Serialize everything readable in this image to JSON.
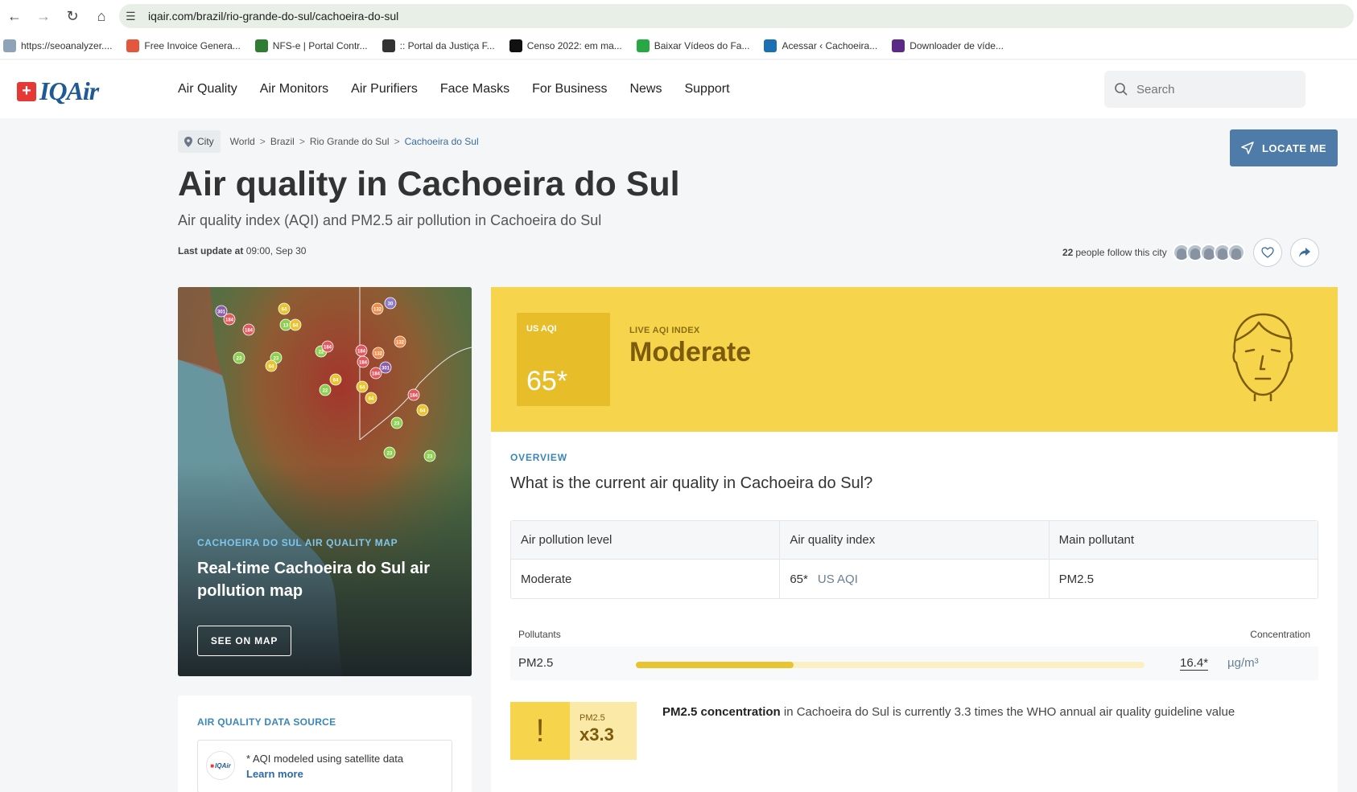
{
  "browser": {
    "url": "iqair.com/brazil/rio-grande-do-sul/cachoeira-do-sul",
    "bookmarks": [
      {
        "label": "https://seoanalyzer....",
        "color": "#8fa3b8"
      },
      {
        "label": "Free Invoice Genera...",
        "color": "#e4573d"
      },
      {
        "label": "NFS-e | Portal Contr...",
        "color": "#2f7d32"
      },
      {
        "label": ":: Portal da Justiça F...",
        "color": "#333333"
      },
      {
        "label": "Censo 2022: em ma...",
        "color": "#111111"
      },
      {
        "label": "Baixar Vídeos do Fa...",
        "color": "#28a745"
      },
      {
        "label": "Acessar ‹ Cachoeira...",
        "color": "#1b6fb5"
      },
      {
        "label": "Downloader de víde...",
        "color": "#5b2a86"
      }
    ]
  },
  "site": {
    "logo_text": "IQAir",
    "nav": [
      "Air Quality",
      "Air Monitors",
      "Air Purifiers",
      "Face Masks",
      "For Business",
      "News",
      "Support"
    ],
    "search_placeholder": "Search"
  },
  "breadcrumb": {
    "chip": "City",
    "items": [
      "World",
      "Brazil",
      "Rio Grande do Sul",
      "Cachoeira do Sul"
    ]
  },
  "locate_label": "LOCATE ME",
  "page": {
    "title": "Air quality in Cachoeira do Sul",
    "subtitle": "Air quality index (AQI) and PM2.5 air pollution in Cachoeira do Sul",
    "last_update_label": "Last update at",
    "last_update_value": "09:00, Sep 30",
    "followers_count": "22",
    "followers_text": "people follow this city"
  },
  "map_card": {
    "kicker": "CACHOEIRA DO SUL AIR QUALITY MAP",
    "title": "Real-time Cachoeira do Sul air pollution map",
    "button": "SEE ON MAP",
    "markers": [
      "301",
      "184",
      "184",
      "64",
      "13",
      "64",
      "23",
      "23",
      "64",
      "22",
      "184",
      "132",
      "30",
      "184",
      "132",
      "184",
      "301",
      "184",
      "64",
      "22",
      "64",
      "64",
      "132",
      "184",
      "64",
      "23",
      "23",
      "23"
    ]
  },
  "data_source": {
    "kicker": "AIR QUALITY DATA SOURCE",
    "logo": "IQAir",
    "text": "* AQI modeled using satellite data",
    "link": "Learn more"
  },
  "aqi": {
    "label": "US AQI",
    "value": "65*",
    "live_label": "LIVE AQI INDEX",
    "status": "Moderate",
    "color": "#f6d54d"
  },
  "overview": {
    "kicker": "OVERVIEW",
    "question": "What is the current air quality in Cachoeira do Sul?",
    "headers": [
      "Air pollution level",
      "Air quality index",
      "Main pollutant"
    ],
    "level": "Moderate",
    "index_value": "65*",
    "index_unit": "US AQI",
    "main_pollutant": "PM2.5"
  },
  "pollutants": {
    "head_left": "Pollutants",
    "head_right": "Concentration",
    "name": "PM2.5",
    "level_fraction": 0.31,
    "value": "16.4*",
    "unit": "µg/m³"
  },
  "who": {
    "label": "PM2.5",
    "value": "x3.3",
    "bold": "PM2.5 concentration",
    "text": " in Cachoeira do Sul is currently 3.3 times the WHO annual air quality guideline value"
  }
}
